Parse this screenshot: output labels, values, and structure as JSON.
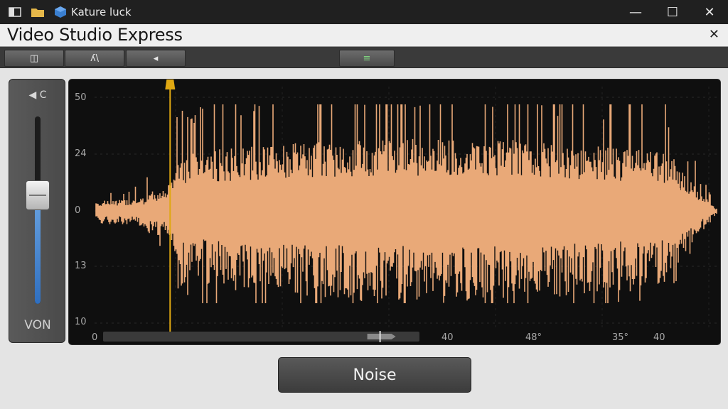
{
  "os": {
    "title": "Kature  luck",
    "icons": [
      "window-icon",
      "folder-icon",
      "cube-app-icon"
    ],
    "controls": {
      "minimize": "—",
      "maximize": "☐",
      "close": "✕"
    }
  },
  "app": {
    "title": "Video Studio Express",
    "close": "✕"
  },
  "toolbar": {
    "buttons": [
      {
        "icon": "split-view-icon",
        "glyph": "◫"
      },
      {
        "icon": "effects-icon",
        "glyph": "ʎ\\"
      },
      {
        "icon": "marker-icon",
        "glyph": "◂"
      },
      {
        "icon": "equalizer-icon",
        "glyph": "≡"
      }
    ]
  },
  "volume": {
    "header": "◀ C",
    "label": "VON",
    "level": 0.58,
    "fill_color": "#3a7ccf"
  },
  "waveform": {
    "y_labels": [
      "50",
      "24",
      "0",
      "13",
      "10"
    ],
    "x_labels": [
      "0",
      "40",
      "48°",
      "35°",
      "40"
    ],
    "wave_color": "#e9a978",
    "playhead_color": "#e0a812",
    "playhead_position": 0.155,
    "scrollbar_position": 0.88
  },
  "noise_button": {
    "label": "Noise"
  }
}
